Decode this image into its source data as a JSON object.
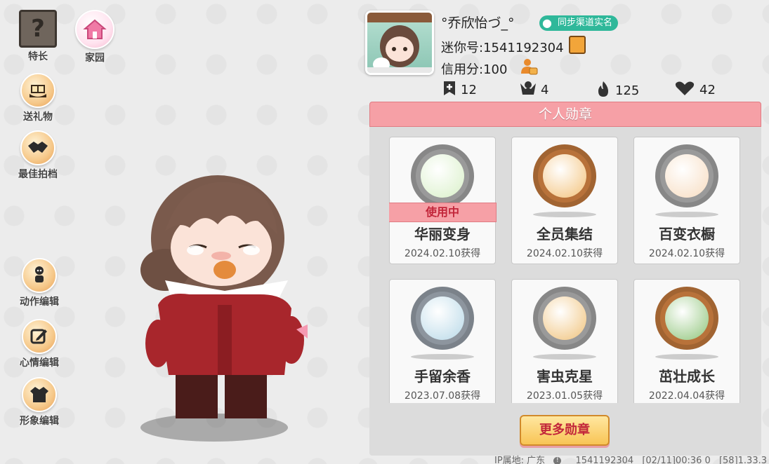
{
  "sidebar": {
    "talent": {
      "label": "特长",
      "glyph": "?"
    },
    "home": {
      "label": "家园"
    },
    "gift": {
      "label": "送礼物"
    },
    "partner": {
      "label": "最佳拍档"
    },
    "action_edit": {
      "label": "动作编辑"
    },
    "mood_edit": {
      "label": "心情编辑"
    },
    "image_edit": {
      "label": "形象编辑"
    }
  },
  "profile": {
    "nickname": "°乔欣怡づ_°",
    "real_name_badge": "同步渠道实名",
    "mini_id_line": "迷你号:1541192304",
    "credit_line": "信用分:100"
  },
  "stats": [
    {
      "icon": "bookmark-plus-icon",
      "value": "12"
    },
    {
      "icon": "fans-icon",
      "value": "4"
    },
    {
      "icon": "fire-icon",
      "value": "125"
    },
    {
      "icon": "heart-hands-icon",
      "value": "42"
    }
  ],
  "medals": {
    "title": "个人勋章",
    "in_use_label": "使用中",
    "items": [
      {
        "name": "华丽变身",
        "date": "2024.02.10获得",
        "rim": "#9a9a9a",
        "inner": "#d9f0c8"
      },
      {
        "name": "全员集结",
        "date": "2024.02.10获得",
        "rim": "#b8723a",
        "inner": "#f3c27a"
      },
      {
        "name": "百变衣橱",
        "date": "2024.02.10获得",
        "rim": "#9a9a9a",
        "inner": "#f7dcc0"
      },
      {
        "name": "手留余香",
        "date": "2023.07.08获得",
        "rim": "#8d959e",
        "inner": "#b8d9e8"
      },
      {
        "name": "害虫克星",
        "date": "2023.01.05获得",
        "rim": "#9a9a9a",
        "inner": "#f0c27a"
      },
      {
        "name": "茁壮成长",
        "date": "2022.04.04获得",
        "rim": "#b8723a",
        "inner": "#8fc57a"
      }
    ],
    "more_button": "更多勋章"
  },
  "footer": {
    "ip": "IP属地: 广东",
    "id": "1541192304",
    "timestamp": "[02/11]00:36 0",
    "version": "[58]1.33.3"
  }
}
